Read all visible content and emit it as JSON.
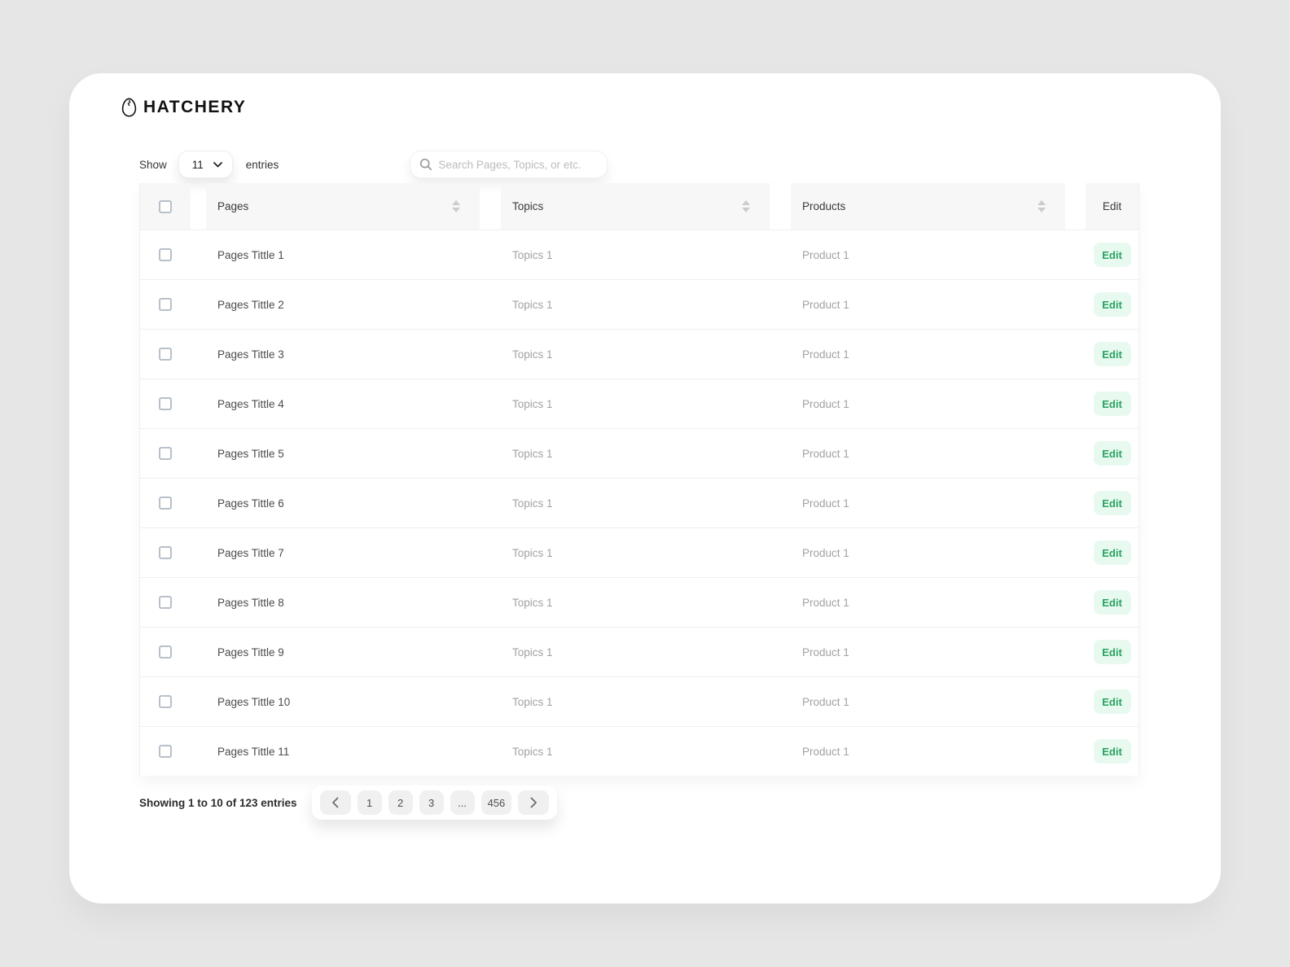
{
  "brand": {
    "name": "HATCHERY",
    "logo_icon": "egg-icon"
  },
  "controls": {
    "show_label": "Show",
    "entries_per_page": "11",
    "entries_label": "entries",
    "search_placeholder": "Search Pages, Topics, or etc.",
    "search_icon": "magnifier-icon"
  },
  "table": {
    "columns": [
      {
        "label": "Pages",
        "sortable": true
      },
      {
        "label": "Topics",
        "sortable": true
      },
      {
        "label": "Products",
        "sortable": true
      }
    ],
    "edit_column_label": "Edit",
    "rows": [
      {
        "page": "Pages Tittle 1",
        "topic": "Topics 1",
        "product": "Product 1",
        "action": "Edit"
      },
      {
        "page": "Pages Tittle 2",
        "topic": "Topics 1",
        "product": "Product 1",
        "action": "Edit"
      },
      {
        "page": "Pages Tittle 3",
        "topic": "Topics 1",
        "product": "Product 1",
        "action": "Edit"
      },
      {
        "page": "Pages Tittle 4",
        "topic": "Topics 1",
        "product": "Product 1",
        "action": "Edit"
      },
      {
        "page": "Pages Tittle 5",
        "topic": "Topics 1",
        "product": "Product 1",
        "action": "Edit"
      },
      {
        "page": "Pages Tittle 6",
        "topic": "Topics 1",
        "product": "Product 1",
        "action": "Edit"
      },
      {
        "page": "Pages Tittle 7",
        "topic": "Topics 1",
        "product": "Product 1",
        "action": "Edit"
      },
      {
        "page": "Pages Tittle 8",
        "topic": "Topics 1",
        "product": "Product 1",
        "action": "Edit"
      },
      {
        "page": "Pages Tittle 9",
        "topic": "Topics 1",
        "product": "Product 1",
        "action": "Edit"
      },
      {
        "page": "Pages Tittle 10",
        "topic": "Topics 1",
        "product": "Product 1",
        "action": "Edit"
      },
      {
        "page": "Pages Tittle 11",
        "topic": "Topics 1",
        "product": "Product 1",
        "action": "Edit"
      }
    ]
  },
  "footer": {
    "summary": "Showing 1 to 10 of 123 entries",
    "pagination": {
      "items": [
        {
          "type": "prev",
          "icon": "chevron-left-icon"
        },
        {
          "type": "page",
          "label": "1"
        },
        {
          "type": "page",
          "label": "2"
        },
        {
          "type": "page",
          "label": "3"
        },
        {
          "type": "ellipsis",
          "label": "..."
        },
        {
          "type": "page",
          "label": "456"
        },
        {
          "type": "next",
          "icon": "chevron-right-icon"
        }
      ]
    }
  },
  "colors": {
    "page_bg": "#e6e6e6",
    "card_bg": "#ffffff",
    "header_cell_bg": "#f7f7f7",
    "row_border": "#efefef",
    "accent_green": "#27a35f",
    "accent_green_bg": "#e8f9f0",
    "muted_text": "#a2a2a2",
    "dark_text": "#2d2d2d",
    "pagination_btn_bg": "#f0f0f1"
  }
}
